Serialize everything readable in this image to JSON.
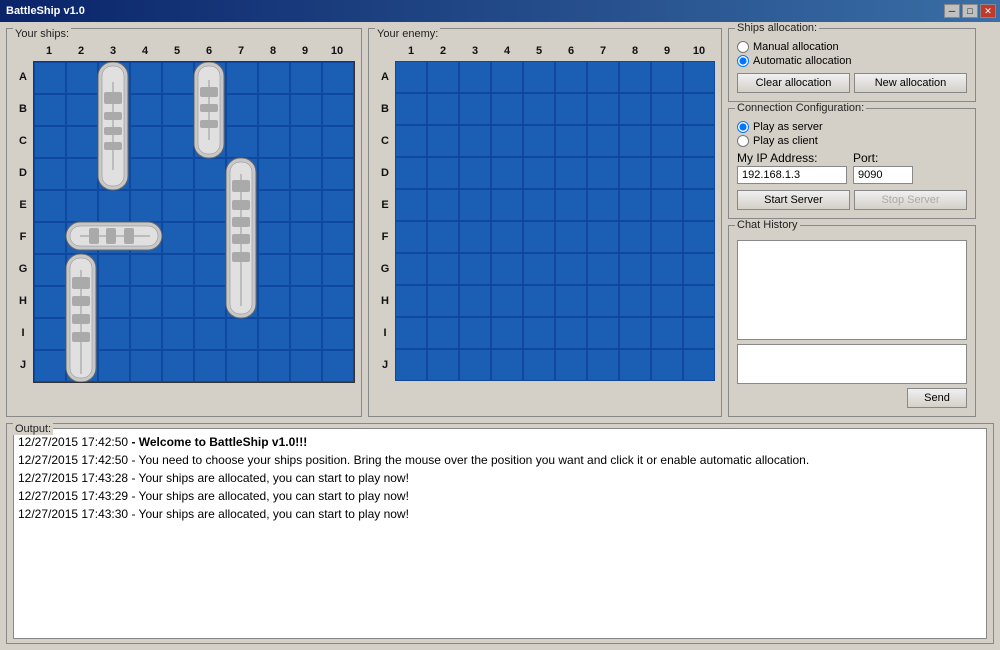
{
  "titleBar": {
    "title": "BattleShip v1.0",
    "minBtn": "─",
    "maxBtn": "□",
    "closeBtn": "✕"
  },
  "yourShips": {
    "label": "Your ships:",
    "cols": [
      "1",
      "2",
      "3",
      "4",
      "5",
      "6",
      "7",
      "8",
      "9",
      "10"
    ],
    "rows": [
      "A",
      "B",
      "C",
      "D",
      "E",
      "F",
      "G",
      "H",
      "I",
      "J"
    ]
  },
  "yourEnemy": {
    "label": "Your enemy:",
    "cols": [
      "1",
      "2",
      "3",
      "4",
      "5",
      "6",
      "7",
      "8",
      "9",
      "10"
    ],
    "rows": [
      "A",
      "B",
      "C",
      "D",
      "E",
      "F",
      "G",
      "H",
      "I",
      "J"
    ]
  },
  "shipsAllocation": {
    "label": "Ships allocation:",
    "manualLabel": "Manual allocation",
    "automaticLabel": "Automatic allocation",
    "clearBtn": "Clear allocation",
    "newBtn": "New allocation"
  },
  "connectionConfig": {
    "label": "Connection Configuration:",
    "serverLabel": "Play as server",
    "clientLabel": "Play as client",
    "ipLabel": "My IP Address:",
    "portLabel": "Port:",
    "ipValue": "192.168.1.3",
    "portValue": "9090",
    "startBtn": "Start Server",
    "stopBtn": "Stop Server"
  },
  "chatHistory": {
    "label": "Chat History"
  },
  "output": {
    "label": "Output:",
    "lines": [
      {
        "time": "12/27/2015 17:42:50",
        "bold": true,
        "text": " - Welcome to BattleShip v1.0!!!"
      },
      {
        "time": "12/27/2015 17:42:50",
        "bold": false,
        "text": " - You need to choose your ships position. Bring the mouse over the position you want and click it or enable automatic allocation."
      },
      {
        "time": "12/27/2015 17:43:28",
        "bold": false,
        "text": " - Your ships are allocated, you can start to play now!"
      },
      {
        "time": "12/27/2015 17:43:29",
        "bold": false,
        "text": " - Your ships are allocated, you can start to play now!"
      },
      {
        "time": "12/27/2015 17:43:30",
        "bold": false,
        "text": " - Your ships are allocated, you can start to play now!"
      }
    ]
  },
  "sendBtn": "Send"
}
